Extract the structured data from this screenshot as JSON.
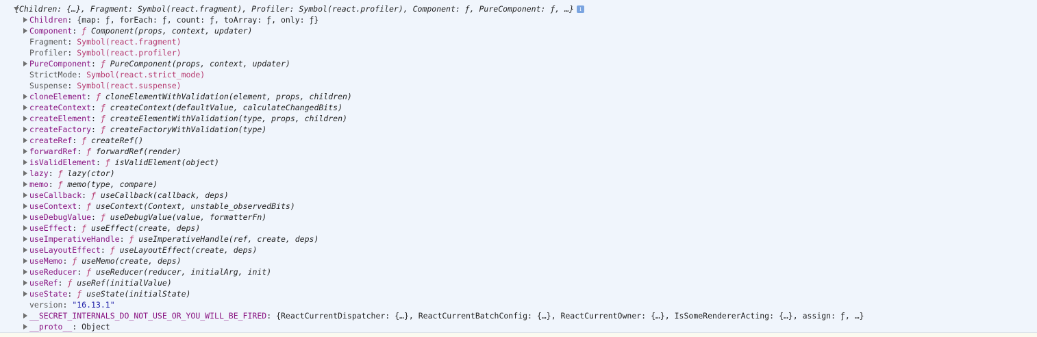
{
  "header": {
    "summary": "{Children: {…}, Fragment: Symbol(react.fragment), Profiler: Symbol(react.profiler), Component: ƒ, PureComponent: ƒ, …}",
    "info_glyph": "i"
  },
  "rows": [
    {
      "expandable": true,
      "key": "Children",
      "sep": ": ",
      "value": "{map: ƒ, forEach: ƒ, count: ƒ, toArray: ƒ, only: ƒ}",
      "kind": "obj"
    },
    {
      "expandable": true,
      "key": "Component",
      "sep": ": ",
      "value": "Component(props, context, updater)",
      "kind": "fn"
    },
    {
      "expandable": false,
      "key": "Fragment",
      "sep": ": ",
      "value": "Symbol(react.fragment)",
      "kind": "sym"
    },
    {
      "expandable": false,
      "key": "Profiler",
      "sep": ": ",
      "value": "Symbol(react.profiler)",
      "kind": "sym"
    },
    {
      "expandable": true,
      "key": "PureComponent",
      "sep": ": ",
      "value": "PureComponent(props, context, updater)",
      "kind": "fn"
    },
    {
      "expandable": false,
      "key": "StrictMode",
      "sep": ": ",
      "value": "Symbol(react.strict_mode)",
      "kind": "sym"
    },
    {
      "expandable": false,
      "key": "Suspense",
      "sep": ": ",
      "value": "Symbol(react.suspense)",
      "kind": "sym"
    },
    {
      "expandable": true,
      "key": "cloneElement",
      "sep": ": ",
      "value": "cloneElementWithValidation(element, props, children)",
      "kind": "fn"
    },
    {
      "expandable": true,
      "key": "createContext",
      "sep": ": ",
      "value": "createContext(defaultValue, calculateChangedBits)",
      "kind": "fn"
    },
    {
      "expandable": true,
      "key": "createElement",
      "sep": ": ",
      "value": "createElementWithValidation(type, props, children)",
      "kind": "fn"
    },
    {
      "expandable": true,
      "key": "createFactory",
      "sep": ": ",
      "value": "createFactoryWithValidation(type)",
      "kind": "fn"
    },
    {
      "expandable": true,
      "key": "createRef",
      "sep": ": ",
      "value": "createRef()",
      "kind": "fn"
    },
    {
      "expandable": true,
      "key": "forwardRef",
      "sep": ": ",
      "value": "forwardRef(render)",
      "kind": "fn"
    },
    {
      "expandable": true,
      "key": "isValidElement",
      "sep": ": ",
      "value": "isValidElement(object)",
      "kind": "fn"
    },
    {
      "expandable": true,
      "key": "lazy",
      "sep": ": ",
      "value": "lazy(ctor)",
      "kind": "fn"
    },
    {
      "expandable": true,
      "key": "memo",
      "sep": ": ",
      "value": "memo(type, compare)",
      "kind": "fn"
    },
    {
      "expandable": true,
      "key": "useCallback",
      "sep": ": ",
      "value": "useCallback(callback, deps)",
      "kind": "fn"
    },
    {
      "expandable": true,
      "key": "useContext",
      "sep": ": ",
      "value": "useContext(Context, unstable_observedBits)",
      "kind": "fn"
    },
    {
      "expandable": true,
      "key": "useDebugValue",
      "sep": ": ",
      "value": "useDebugValue(value, formatterFn)",
      "kind": "fn"
    },
    {
      "expandable": true,
      "key": "useEffect",
      "sep": ": ",
      "value": "useEffect(create, deps)",
      "kind": "fn"
    },
    {
      "expandable": true,
      "key": "useImperativeHandle",
      "sep": ": ",
      "value": "useImperativeHandle(ref, create, deps)",
      "kind": "fn"
    },
    {
      "expandable": true,
      "key": "useLayoutEffect",
      "sep": ": ",
      "value": "useLayoutEffect(create, deps)",
      "kind": "fn"
    },
    {
      "expandable": true,
      "key": "useMemo",
      "sep": ": ",
      "value": "useMemo(create, deps)",
      "kind": "fn"
    },
    {
      "expandable": true,
      "key": "useReducer",
      "sep": ": ",
      "value": "useReducer(reducer, initialArg, init)",
      "kind": "fn"
    },
    {
      "expandable": true,
      "key": "useRef",
      "sep": ": ",
      "value": "useRef(initialValue)",
      "kind": "fn"
    },
    {
      "expandable": true,
      "key": "useState",
      "sep": ": ",
      "value": "useState(initialState)",
      "kind": "fn"
    },
    {
      "expandable": false,
      "key": "version",
      "sep": ": ",
      "value": "\"16.13.1\"",
      "kind": "str"
    },
    {
      "expandable": true,
      "key": "__SECRET_INTERNALS_DO_NOT_USE_OR_YOU_WILL_BE_FIRED",
      "sep": ": ",
      "value": "{ReactCurrentDispatcher: {…}, ReactCurrentBatchConfig: {…}, ReactCurrentOwner: {…}, IsSomeRendererActing: {…}, assign: ƒ, …}",
      "kind": "obj"
    },
    {
      "expandable": true,
      "key": "__proto__",
      "sep": ": ",
      "value": "Object",
      "kind": "plain"
    }
  ],
  "fn_prefix": "ƒ ",
  "colors": {
    "background": "#f0f5fc",
    "key": "#881280",
    "symbol": "#c80000",
    "string": "#1a1aa6",
    "function_glyph": "#b5376d",
    "info_badge": "#7aa4e0"
  }
}
